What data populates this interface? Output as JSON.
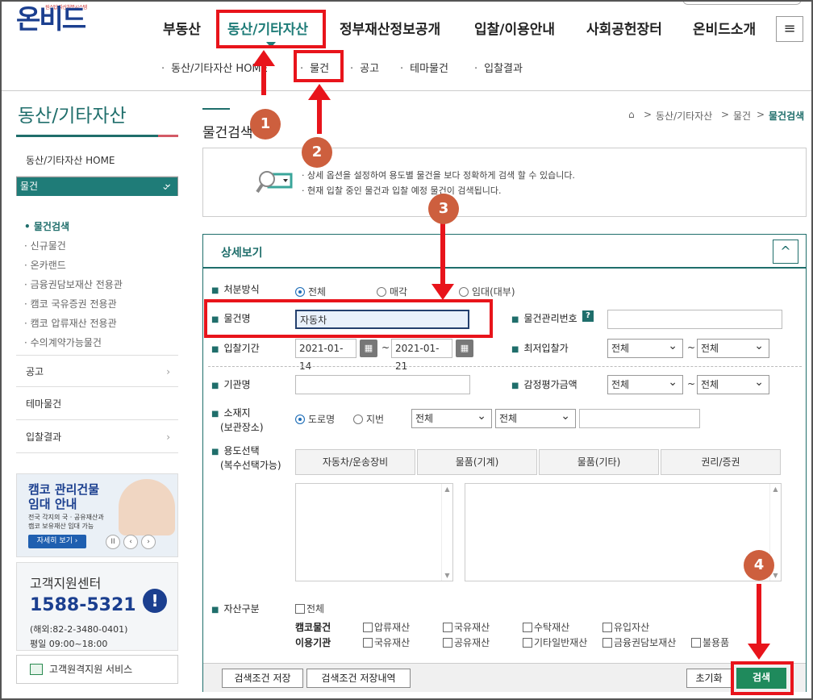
{
  "header": {
    "logo_small": "원스탑 자산처분시스템",
    "logo": "온비드",
    "gnb": [
      "부동산",
      "동산/기타자산",
      "정부재산정보공개",
      "입찰/이용안내",
      "사회공헌장터",
      "온비드소개"
    ],
    "menu_icon": "≡",
    "subnav": [
      "동산/기타자산 HOME",
      "물건",
      "공고",
      "테마물건",
      "입찰결과"
    ]
  },
  "lnb": {
    "title": "동산/기타자산",
    "items": [
      "동산/기타자산 HOME",
      "물건",
      "공고",
      "테마물건",
      "입찰결과"
    ],
    "chev_down": "⌄",
    "chev_right": "›",
    "sub_items": [
      "물건검색",
      "신규물건",
      "온카랜드",
      "금융권담보재산 전용관",
      "캠코 국유증권 전용관",
      "캠코 압류재산 전용관",
      "수의계약가능물건"
    ],
    "banner": {
      "title1": "캠코 관리건물",
      "title2": "임대 안내",
      "desc1": "전국 각지의 국 · 공유재산과",
      "desc2": "캠코 보유재산 임대 가능",
      "btn": "자세히 보기 ›",
      "pause": "II",
      "prev": "‹",
      "next": "›"
    },
    "cs": {
      "title": "고객지원센터",
      "number": "1588-5321",
      "overseas": "(해외:82-2-3480-0401)",
      "hours": "평일 09:00~18:00",
      "alert": "!"
    },
    "remote": "고객원격지원 서비스"
  },
  "content": {
    "title": "물건검색",
    "breadcrumb": [
      "⌂",
      ">",
      "동산/기타자산",
      ">",
      "물건",
      ">",
      "물건검색"
    ],
    "info1": "· 상세 옵션을 설정하여 용도별 물건을 보다 정확하게 검색 할 수 있습니다.",
    "info2": "· 현재 입찰 중인 물건과 입찰 예정 물건이 검색됩니다.",
    "panel_title": "상세보기",
    "collapse": "^"
  },
  "form": {
    "bullet": "■",
    "disposal_label": "처분방식",
    "disposal_opts": [
      "전체",
      "매각",
      "임대(대부)"
    ],
    "name_label": "물건명",
    "name_value": "자동차",
    "mgmt_label": "물건관리번호",
    "help": "?",
    "period_label": "입찰기간",
    "date_from": "2021-01-14",
    "date_to": "2021-01-21",
    "cal_icon": "▦",
    "tilde": "~",
    "min_label": "최저입찰가",
    "select_all": "전체",
    "org_label": "기관명",
    "appraisal_label": "감정평가금액",
    "loc_label1": "소재지",
    "loc_label2": "(보관장소)",
    "loc_opts": [
      "도로명",
      "지번"
    ],
    "use_label1": "용도선택",
    "use_label2": "(복수선택가능)",
    "use_tabs": [
      "자동차/운송장비",
      "물품(기계)",
      "물품(기타)",
      "권리/증권"
    ],
    "up": "▲",
    "down": "▼",
    "asset_label": "자산구분",
    "asset_all": "전체",
    "kamco_label": "캠코물건",
    "kamco_opts": [
      "압류재산",
      "국유재산",
      "수탁재산",
      "유입자산"
    ],
    "org_use_label": "이용기관",
    "org_use_opts": [
      "국유재산",
      "공유재산",
      "기타일반재산",
      "금융권담보재산",
      "불용품"
    ]
  },
  "footer": {
    "save": "검색조건 저장",
    "saved": "검색조건 저장내역",
    "reset": "초기화",
    "search": "검색"
  },
  "annotations": [
    "1",
    "2",
    "3",
    "4"
  ],
  "colors": {
    "accent": "#1f7c78",
    "annotation": "#e8141b",
    "badge": "#cd5f3e"
  }
}
